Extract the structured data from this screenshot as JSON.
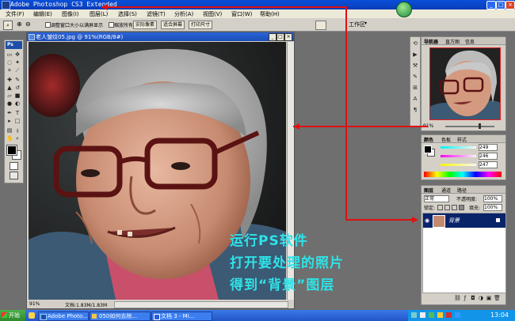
{
  "app": {
    "title": "Adobe Photoshop CS3 Extended",
    "min": "_",
    "max": "□",
    "close": "×"
  },
  "menu": [
    "文件(F)",
    "编辑(E)",
    "图像(I)",
    "图层(L)",
    "选择(S)",
    "滤镜(T)",
    "分析(A)",
    "视图(V)",
    "窗口(W)",
    "帮助(H)"
  ],
  "options": {
    "resize_label": "调整窗口大小以满屏显示",
    "zoom_all_label": "缩放所有窗口",
    "actual_pixels": "实际像素",
    "fit_screen": "适合屏幕",
    "print_size": "打印尺寸",
    "workspace": "工作区"
  },
  "document": {
    "title": "老人皱纹05.jpg @ 91%(RGB/8#)",
    "zoom": "91%",
    "doc_size": "文档:1.83M/1.83M"
  },
  "navigator": {
    "tabs": [
      "导航器",
      "直方图",
      "信息"
    ],
    "zoom": "91%"
  },
  "color": {
    "tabs": [
      "颜色",
      "色板",
      "样式"
    ],
    "r": "249",
    "g": "246",
    "b": "247"
  },
  "layers": {
    "tabs": [
      "图层",
      "通道",
      "路径"
    ],
    "blend_mode": "正常",
    "opacity_label": "不透明度:",
    "opacity": "100%",
    "lock_label": "锁定:",
    "fill_label": "填充:",
    "fill": "100%",
    "layer_name": "背景"
  },
  "annotation": {
    "line1": "运行PS软件",
    "line2": "打开要处理的照片",
    "line3": "得到“背景”图层"
  },
  "taskbar": {
    "start": "开始",
    "items": [
      "Adobe Photo...",
      "050如何去除...",
      "文档 3 - Mi..."
    ],
    "time": "13:04"
  },
  "colors": {
    "annotation_text": "#2ee3e8",
    "arrow": "#e01010",
    "titlebar": "#0a4fd8",
    "layer_selected": "#0a246a"
  }
}
